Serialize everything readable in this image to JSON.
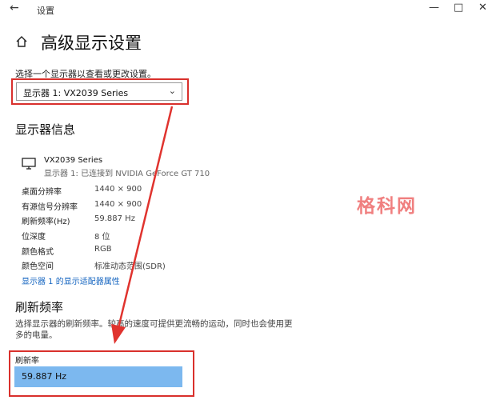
{
  "window": {
    "title": "设置"
  },
  "page": {
    "title": "高级显示设置"
  },
  "display_select": {
    "label": "选择一个显示器以查看或更改设置。",
    "value": "显示器 1: VX2039 Series"
  },
  "display_info": {
    "heading": "显示器信息",
    "monitor_name": "VX2039 Series",
    "monitor_connection": "显示器 1: 已连接到 NVIDIA GeForce GT 710",
    "rows": [
      {
        "label": "桌面分辨率",
        "value": "1440 × 900"
      },
      {
        "label": "有源信号分辨率",
        "value": "1440 × 900"
      },
      {
        "label": "刷新频率(Hz)",
        "value": "59.887 Hz"
      },
      {
        "label": "位深度",
        "value": "8 位"
      },
      {
        "label": "颜色格式",
        "value": "RGB"
      },
      {
        "label": "颜色空间",
        "value": "标准动态范围(SDR)"
      }
    ],
    "adapter_link": "显示器 1 的显示适配器属性"
  },
  "refresh": {
    "heading": "刷新频率",
    "description": "选择显示器的刷新频率。较高的速度可提供更流畅的运动，同时也会使用更多的电量。",
    "label": "刷新率",
    "value": "59.887 Hz"
  },
  "watermark": "格科网",
  "colors": {
    "highlight_box": "#d9302c",
    "arrow": "#e0332e",
    "selected_item": "#7cb8ef",
    "link": "#1565c0"
  },
  "icons": {
    "back": "back-arrow-icon",
    "home": "home-icon",
    "monitor": "monitor-icon",
    "chevron": "chevron-down-icon"
  }
}
